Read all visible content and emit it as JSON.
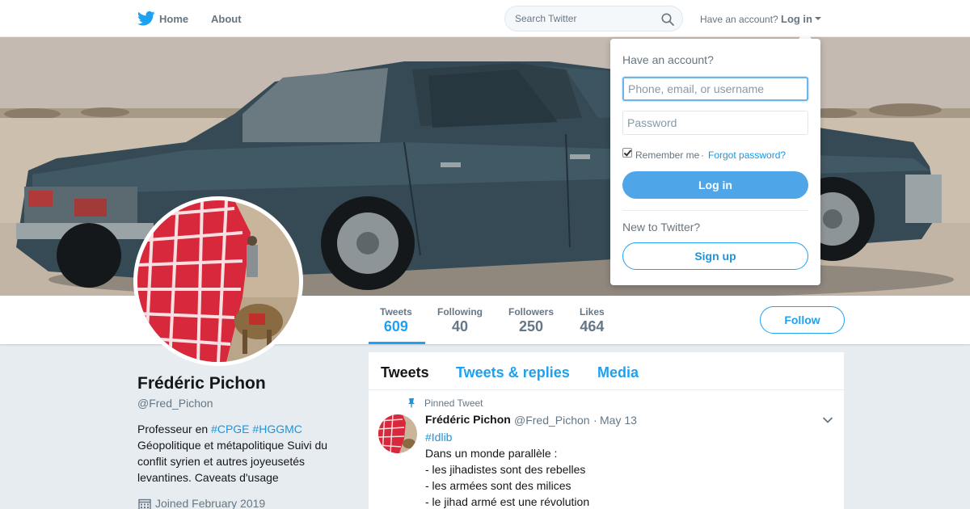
{
  "nav": {
    "home_label": "Home",
    "about_label": "About",
    "search_placeholder": "Search Twitter",
    "have_account_text": "Have an account?",
    "login_label": "Log in"
  },
  "login_dropdown": {
    "title": "Have an account?",
    "username_placeholder": "Phone, email, or username",
    "password_placeholder": "Password",
    "remember_label": "Remember me",
    "separator": "·",
    "forgot_label": "Forgot password?",
    "login_button": "Log in",
    "new_text": "New to Twitter?",
    "signup_button": "Sign up",
    "remember_checked": true
  },
  "profile": {
    "name": "Frédéric Pichon",
    "handle": "@Fred_Pichon",
    "bio": {
      "prefix": "Professeur en ",
      "tag1": "#CPGE",
      "tag2": "#HGGMC",
      "rest": "Géopolitique et métapolitique Suivi du conflit syrien et autres joyeusetés levantines. Caveats d'usage"
    },
    "joined": "Joined February 2019"
  },
  "stats": [
    {
      "label": "Tweets",
      "value": "609"
    },
    {
      "label": "Following",
      "value": "40"
    },
    {
      "label": "Followers",
      "value": "250"
    },
    {
      "label": "Likes",
      "value": "464"
    }
  ],
  "follow_button": "Follow",
  "timeline": {
    "tabs": [
      "Tweets",
      "Tweets & replies",
      "Media"
    ],
    "pinned_label": "Pinned Tweet",
    "tweet": {
      "name": "Frédéric Pichon",
      "handle": "@Fred_Pichon",
      "dot": "·",
      "date": "May 13",
      "lines": [
        "#Idlib",
        "Dans un monde parallèle :",
        "- les jihadistes sont des rebelles",
        "- les armées sont des milices",
        "- le jihad armé est une révolution"
      ]
    }
  },
  "colors": {
    "accent": "#1da1f2",
    "link": "#1b95e0",
    "text": "#14171a",
    "muted": "#657786",
    "background": "#e6ecf0"
  },
  "icons": [
    "twitter-bird-icon",
    "search-icon",
    "caret-down-icon",
    "pin-icon",
    "calendar-icon",
    "chevron-down-icon"
  ]
}
